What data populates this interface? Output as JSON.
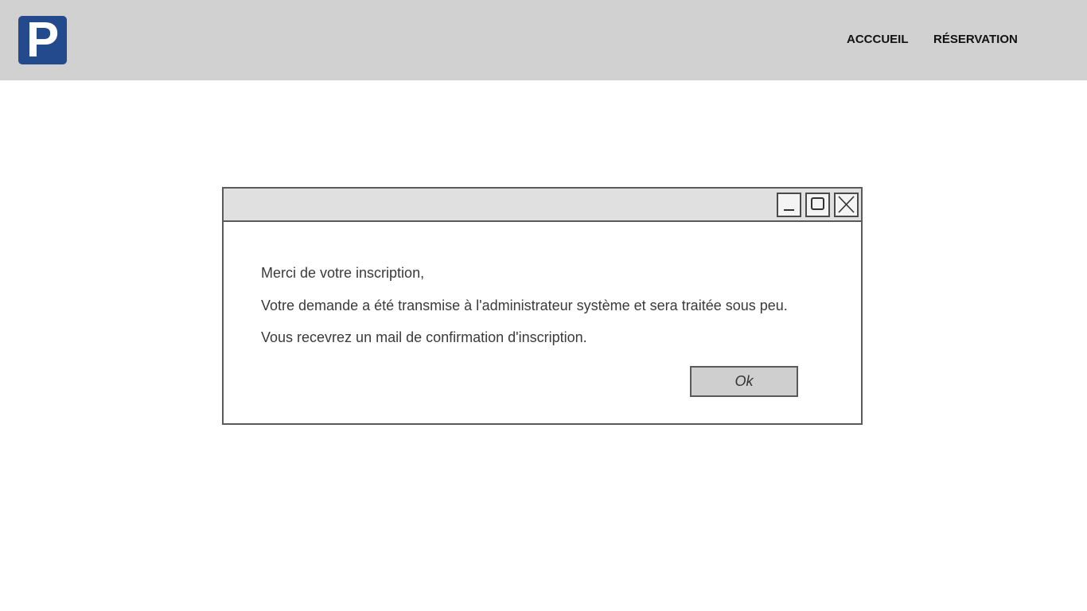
{
  "header": {
    "logo_letter": "P",
    "brand_color": "#224a8c",
    "nav": {
      "home_label": "ACCCUEIL",
      "reservation_label": "RÉSERVATION"
    }
  },
  "dialog": {
    "window_controls": [
      "minimize-icon",
      "maximize-icon",
      "close-icon"
    ],
    "message_lines": [
      "Merci de votre inscription,",
      "Votre demande a été transmise à l'administrateur système et sera traitée sous peu.",
      "Vous recevrez un mail de confirmation d'inscription."
    ],
    "ok_label": "Ok"
  }
}
